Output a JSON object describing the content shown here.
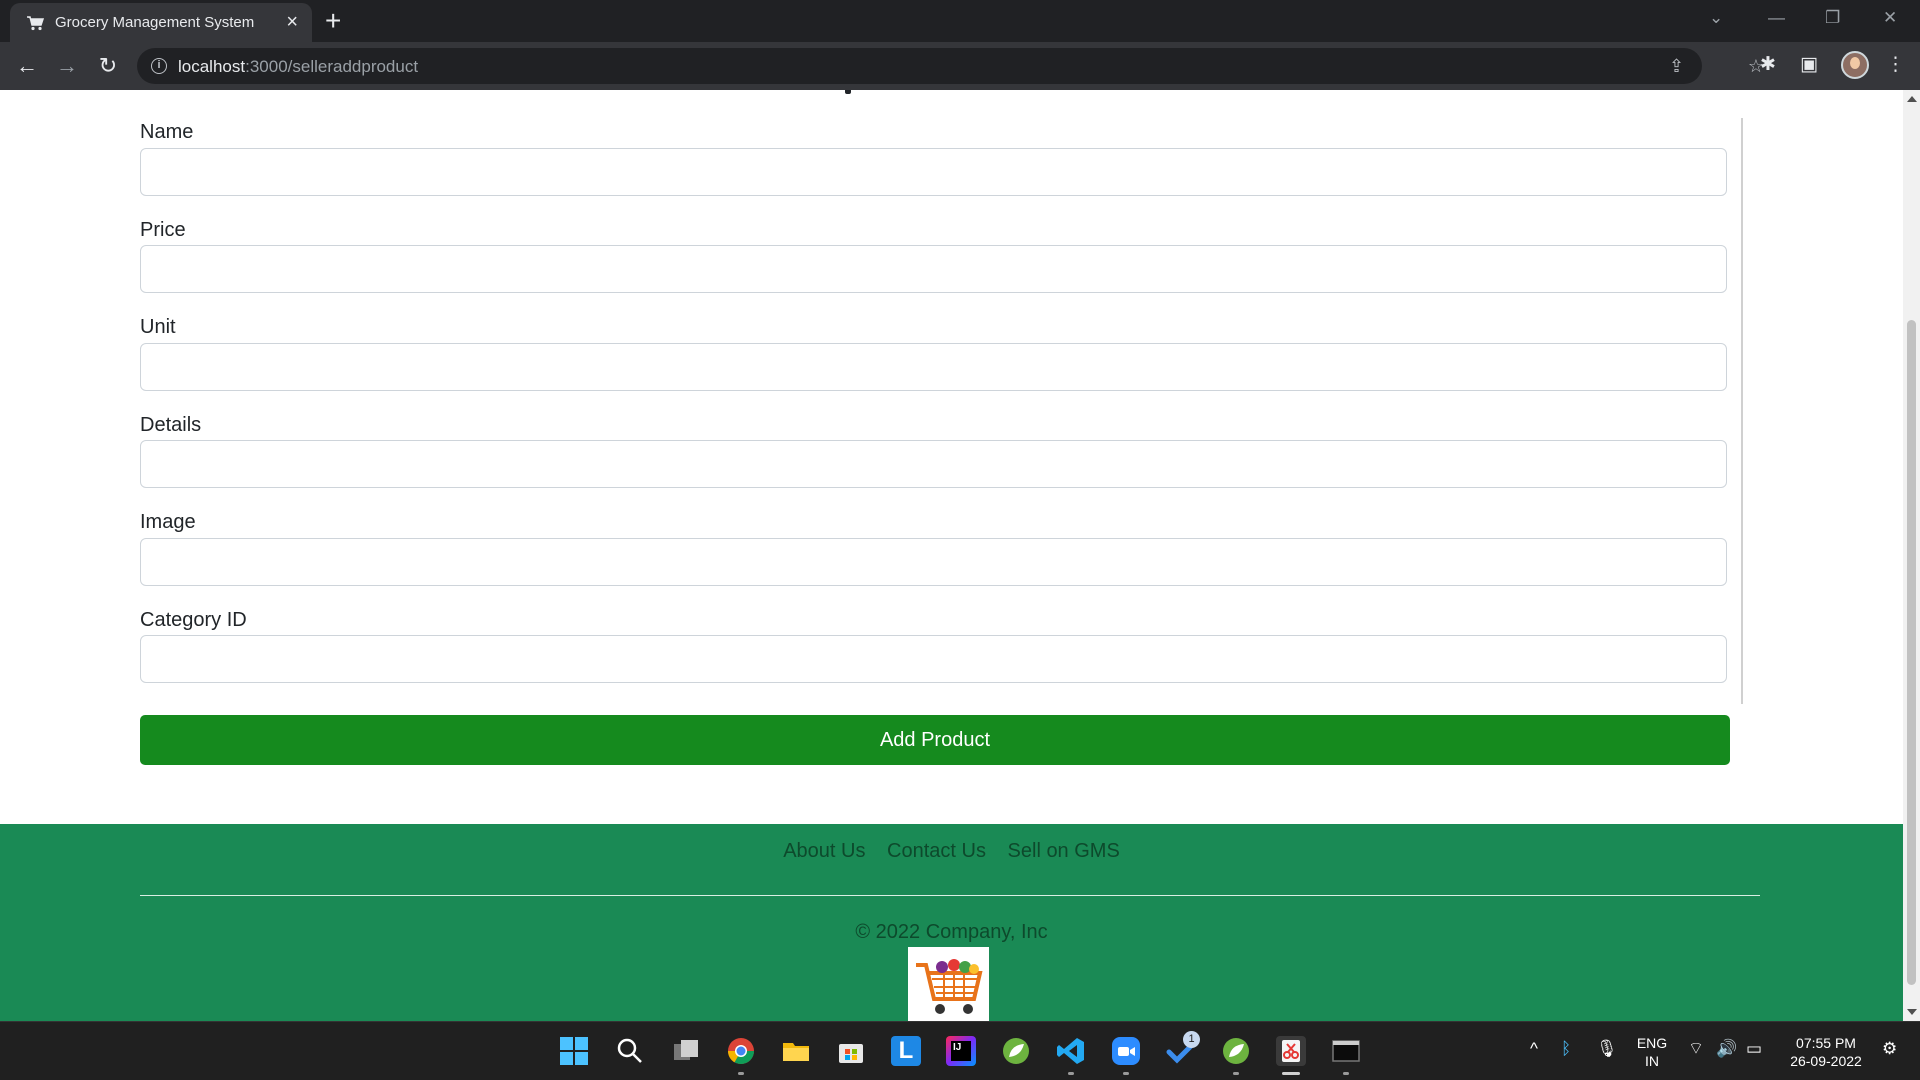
{
  "browser": {
    "tab_title": "Grocery Management System",
    "url_host": "localhost",
    "url_rest": ":3000/selleraddproduct"
  },
  "form": {
    "fields": [
      {
        "label": "Name",
        "value": ""
      },
      {
        "label": "Price",
        "value": ""
      },
      {
        "label": "Unit",
        "value": ""
      },
      {
        "label": "Details",
        "value": ""
      },
      {
        "label": "Image",
        "value": ""
      },
      {
        "label": "Category ID",
        "value": ""
      }
    ],
    "submit_label": "Add Product",
    "submit_color": "#158a1e"
  },
  "footer": {
    "links": [
      "About Us",
      "Contact Us",
      "Sell on GMS"
    ],
    "copyright": "© 2022 Company, Inc",
    "background_color": "#1a8a55"
  },
  "taskbar": {
    "apps": [
      "windows-start-icon",
      "search-icon",
      "task-view-icon",
      "chrome-icon",
      "file-explorer-icon",
      "microsoft-store-icon",
      "l-app-icon",
      "intellij-icon",
      "spring-tool-icon",
      "vscode-icon",
      "zoom-icon",
      "todo-icon",
      "spring-tool-icon-2",
      "snipping-tool-icon",
      "terminal-icon"
    ],
    "todo_badge": "1",
    "language": "ENG",
    "region": "IN",
    "time": "07:55 PM",
    "date": "26-09-2022"
  }
}
